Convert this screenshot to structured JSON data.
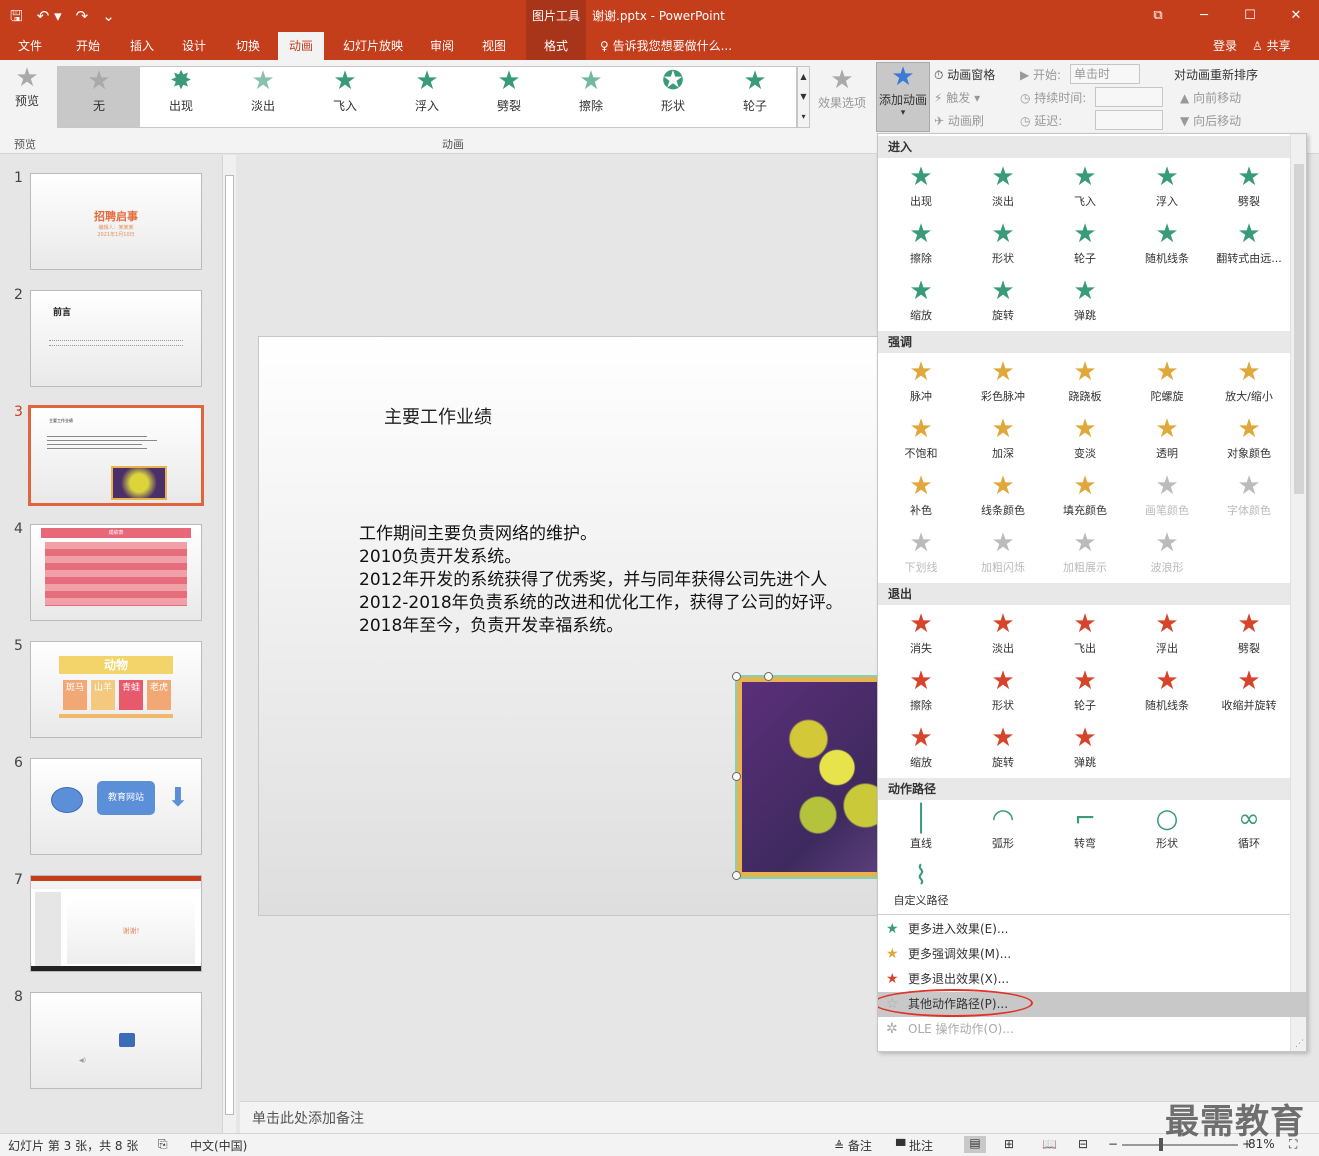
{
  "titlebar": {
    "context_tool": "图片工具",
    "doc_title": "谢谢.pptx - PowerPoint",
    "qat": {
      "save": "🖫",
      "undo": "↶ ▾",
      "redo": "↷",
      "customize": "⌄"
    },
    "win": {
      "restore_ribbon": "⧉",
      "minimize": "─",
      "maximize": "☐",
      "close": "✕"
    }
  },
  "tabs": {
    "file": "文件",
    "home": "开始",
    "insert": "插入",
    "design": "设计",
    "transitions": "切换",
    "animations": "动画",
    "slideshow": "幻灯片放映",
    "review": "审阅",
    "view": "视图",
    "format": "格式",
    "tellme": "♀ 告诉我您想要做什么...",
    "login": "登录",
    "share": "♙ 共享"
  },
  "ribbon": {
    "preview": "预览",
    "preview_group": "预览",
    "animation_group": "动画",
    "gallery": [
      "无",
      "出现",
      "淡出",
      "飞入",
      "浮入",
      "劈裂",
      "擦除",
      "形状",
      "轮子"
    ],
    "effect_options": "效果选项",
    "add_animation": "添加动画",
    "anim_pane": "动画窗格",
    "trigger": "触发",
    "anim_painter": "动画刷",
    "start_label": "开始:",
    "start_value": "单击时",
    "duration_label": "持续时间:",
    "delay_label": "延迟:",
    "reorder": "对动画重新排序",
    "move_earlier": "向前移动",
    "move_later": "向后移动"
  },
  "thumbs": [
    {
      "num": "1",
      "title": "招聘启事",
      "sub1": "编辑人：某某某",
      "sub2": "2021年1月10日"
    },
    {
      "num": "2",
      "title": "前言"
    },
    {
      "num": "3",
      "title": "主要工作业绩"
    },
    {
      "num": "4",
      "title": "成绩表"
    },
    {
      "num": "5",
      "title": "动物",
      "tiles": [
        "斑马",
        "山羊",
        "青蛙",
        "老虎"
      ]
    },
    {
      "num": "6",
      "label": "教育网站"
    },
    {
      "num": "7",
      "label": "谢谢!"
    },
    {
      "num": "8"
    }
  ],
  "slide": {
    "title": "主要工作业绩",
    "body": [
      "工作期间主要负责网络的维护。",
      "2010负责开发系统。",
      "2012年开发的系统获得了优秀奖，并与同年获得公司先进个人",
      "2012-2018年负责系统的改进和优化工作，获得了公司的好评。",
      "2018年至今，负责开发幸福系统。"
    ]
  },
  "notes_placeholder": "单击此处添加备注",
  "dropdown": {
    "sections": {
      "entrance": "进入",
      "emphasis": "强调",
      "exit": "退出",
      "paths": "动作路径"
    },
    "entrance": [
      "出现",
      "淡出",
      "飞入",
      "浮入",
      "劈裂",
      "擦除",
      "形状",
      "轮子",
      "随机线条",
      "翻转式由远...",
      "缩放",
      "旋转",
      "弹跳"
    ],
    "emphasis": [
      "脉冲",
      "彩色脉冲",
      "跷跷板",
      "陀螺旋",
      "放大/缩小",
      "不饱和",
      "加深",
      "变淡",
      "透明",
      "对象颜色",
      "补色",
      "线条颜色",
      "填充颜色",
      "画笔颜色",
      "字体颜色",
      "下划线",
      "加粗闪烁",
      "加粗展示",
      "波浪形"
    ],
    "exit": [
      "消失",
      "淡出",
      "飞出",
      "浮出",
      "劈裂",
      "擦除",
      "形状",
      "轮子",
      "随机线条",
      "收缩并旋转",
      "缩放",
      "旋转",
      "弹跳"
    ],
    "paths": [
      "直线",
      "弧形",
      "转弯",
      "形状",
      "循环",
      "自定义路径"
    ],
    "menu": {
      "more_entrance": "更多进入效果(E)...",
      "more_emphasis": "更多强调效果(M)...",
      "more_exit": "更多退出效果(X)...",
      "other_paths": "其他动作路径(P)...",
      "ole": "OLE 操作动作(O)..."
    }
  },
  "status": {
    "slide_info": "幻灯片 第 3 张，共 8 张",
    "language": "中文(中国)",
    "notes": "≜ 备注",
    "comments": "▀ 批注",
    "zoom": "81%"
  },
  "watermark": "最需教育",
  "colors": {
    "accent": "#c43e1c",
    "entrance": "#3a9b7a",
    "emphasis": "#e0a83a",
    "exit": "#d6442c",
    "highlight_circle": "#e0342a"
  }
}
